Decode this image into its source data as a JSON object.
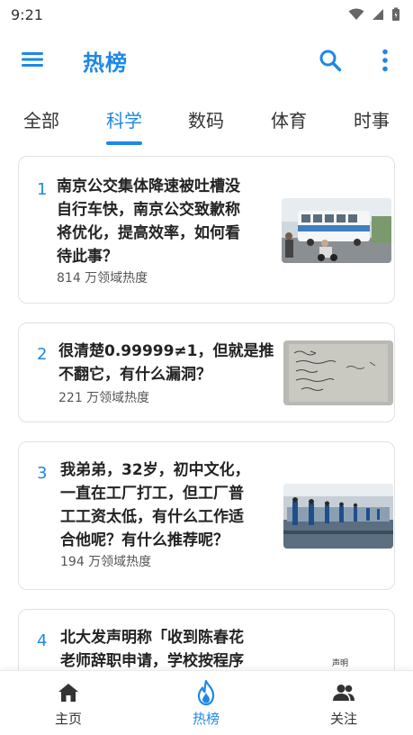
{
  "status_bar": {
    "time": "9:21"
  },
  "app_bar": {
    "title": "热榜"
  },
  "tabs": [
    {
      "label": "全部"
    },
    {
      "label": "科学",
      "active": true
    },
    {
      "label": "数码"
    },
    {
      "label": "体育"
    },
    {
      "label": "时事"
    }
  ],
  "feed": [
    {
      "rank": "1",
      "title": [
        "南京公交集体降速被吐槽没",
        "自行车快，南京公交致歉称",
        "将优化，提高效率，如何看",
        "待此事？"
      ],
      "heat": "814 万领域热度",
      "thumb": "bus-street-photo"
    },
    {
      "rank": "2",
      "title": [
        "很清楚0.99999≠1，但就是推",
        "不翻它，有什么漏洞？"
      ],
      "heat": "221 万领域热度",
      "thumb": "handwritten-math-photo"
    },
    {
      "rank": "3",
      "title": [
        "我弟弟，32岁，初中文化，",
        "一直在工厂打工，但工厂普",
        "工工资太低，有什么工作适",
        "合他呢？有什么推荐呢？"
      ],
      "heat": "194 万领域热度",
      "thumb": "factory-workers-photo"
    },
    {
      "rank": "4",
      "title": [
        "北大发声明称「收到陈春花",
        "老师辞职申请，学校按程序"
      ],
      "heat": "",
      "thumb_text": "声明"
    }
  ],
  "bottom_nav": [
    {
      "label": "主页",
      "icon": "home-icon"
    },
    {
      "label": "热榜",
      "icon": "flame-icon",
      "active": true
    },
    {
      "label": "关注",
      "icon": "people-icon"
    }
  ],
  "colors": {
    "accent": "#1e88e5",
    "text": "#222222",
    "muted": "#555555",
    "border": "#e2e2e2"
  }
}
